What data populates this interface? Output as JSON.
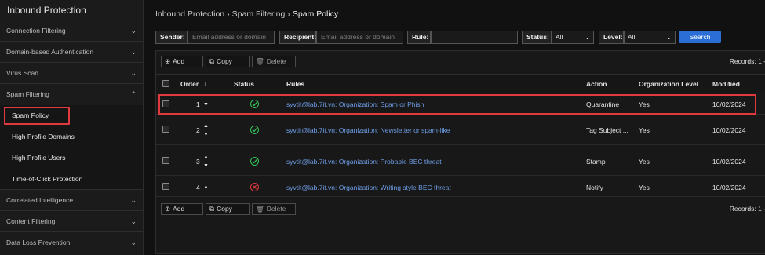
{
  "sidebar": {
    "title": "Inbound Protection",
    "sections": [
      {
        "label": "Connection Filtering",
        "chevron": "chevron-down-icon"
      },
      {
        "label": "Domain-based Authentication",
        "chevron": "chevron-down-icon"
      },
      {
        "label": "Virus Scan",
        "chevron": "chevron-down-icon"
      },
      {
        "label": "Spam Filtering",
        "chevron": "chevron-up-icon"
      }
    ],
    "spam_items": [
      "Spam Policy",
      "High Profile Domains",
      "High Profile Users",
      "Time-of-Click Protection"
    ],
    "lower_sections": [
      {
        "label": "Correlated Intelligence",
        "chevron": "chevron-down-icon"
      },
      {
        "label": "Content Filtering",
        "chevron": "chevron-down-icon"
      },
      {
        "label": "Data Loss Prevention",
        "chevron": "chevron-down-icon"
      }
    ]
  },
  "breadcrumb": {
    "items": [
      "Inbound Protection",
      "Spam Filtering"
    ],
    "separator": "›",
    "current": "Spam Policy"
  },
  "filters": {
    "sender_label": "Sender:",
    "sender_placeholder": "Email address or domain",
    "recipient_label": "Recipient:",
    "recipient_placeholder": "Email address or domain",
    "rule_label": "Rule:",
    "rule_value": "",
    "status_label": "Status:",
    "status_value": "All",
    "level_label": "Level:",
    "level_value": "All",
    "search_label": "Search"
  },
  "toolbar": {
    "add": "Add",
    "copy": "Copy",
    "delete": "Delete",
    "records": "Records: 1 -"
  },
  "table": {
    "columns": [
      "Order",
      "Status",
      "Rules",
      "Action",
      "Organization Level",
      "Modified"
    ],
    "rows": [
      {
        "order": "1",
        "status": "enabled",
        "rule": "syvtit@lab.7it.vn: Organization: Spam or Phish",
        "action": "Quarantine",
        "org_level": "Yes",
        "modified": "10/02/2024"
      },
      {
        "order": "2",
        "status": "enabled",
        "rule": "syvtit@lab.7it.vn: Organization: Newsletter or spam-like",
        "action": "Tag Subject ...",
        "org_level": "Yes",
        "modified": "10/02/2024"
      },
      {
        "order": "3",
        "status": "enabled",
        "rule": "syvtit@lab.7it.vn: Organization: Probable BEC threat",
        "action": "Stamp",
        "org_level": "Yes",
        "modified": "10/02/2024"
      },
      {
        "order": "4",
        "status": "disabled",
        "rule": "syvtit@lab.7it.vn: Organization: Writing style BEC threat",
        "action": "Notify",
        "org_level": "Yes",
        "modified": "10/02/2024"
      }
    ]
  },
  "colors": {
    "accent": "#2b6fd6",
    "highlight": "#e0393e",
    "status_ok": "#35c45a",
    "status_bad": "#e0393e",
    "link": "#6f9fe8"
  }
}
